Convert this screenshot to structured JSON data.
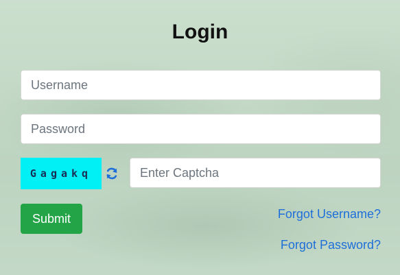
{
  "login": {
    "title": "Login",
    "username_placeholder": "Username",
    "password_placeholder": "Password",
    "captcha_text": "Gagakq",
    "captcha_placeholder": "Enter Captcha",
    "submit_label": "Submit",
    "forgot_username_label": "Forgot Username?",
    "forgot_password_label": "Forgot Password?"
  },
  "icons": {
    "refresh": "refresh-icon"
  },
  "colors": {
    "captcha_background": "#00f0f6",
    "submit_background": "#22a447",
    "link": "#1e6fd9",
    "refresh_icon": "#1e6fd9"
  }
}
